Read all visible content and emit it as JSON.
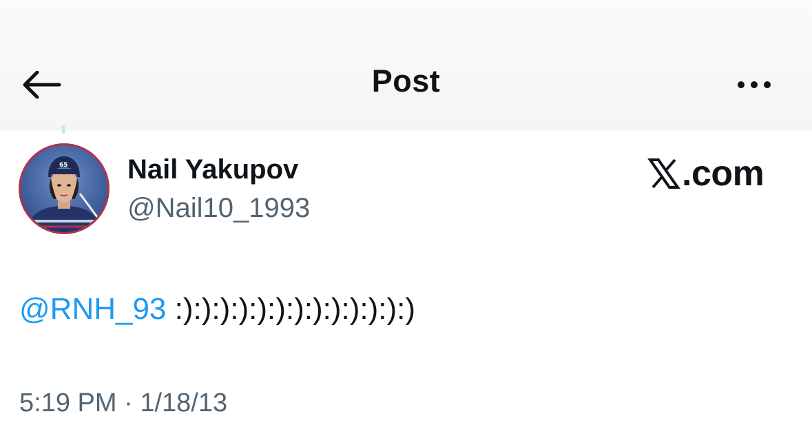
{
  "header": {
    "title": "Post",
    "back_icon": "arrow-left-icon",
    "more_icon": "more-horizontal-icon"
  },
  "author": {
    "name": "Nail Yakupov",
    "handle": "@Nail10_1993",
    "avatar_ring_color": "#b0344a"
  },
  "brand": {
    "label": ".com",
    "logo_icon": "x-logo-icon"
  },
  "post": {
    "mention": "@RNH_93",
    "text": " :):):):):):):):):):):):):)",
    "mention_color": "#1d9bf0"
  },
  "meta": {
    "time": "5:19 PM",
    "separator": " · ",
    "date": "1/18/13"
  }
}
